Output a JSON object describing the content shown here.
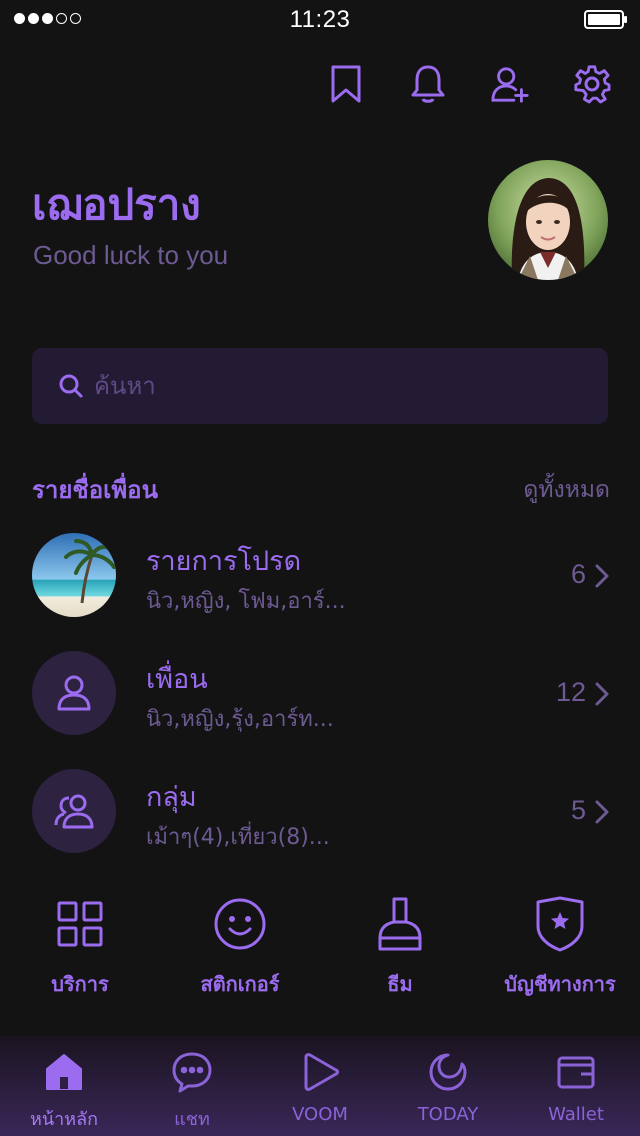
{
  "status_bar": {
    "time": "11:23",
    "signal_filled": 3,
    "signal_total": 5
  },
  "header_icons": [
    "bookmark-icon",
    "bell-icon",
    "add-friend-icon",
    "gear-icon"
  ],
  "profile": {
    "name": "เฌอปราง",
    "status": "Good luck to you",
    "avatar": "profile-photo"
  },
  "search": {
    "placeholder": "ค้นหา"
  },
  "friends_section": {
    "title": "รายชื่อเพื่อน",
    "see_all": "ดูทั้งหมด",
    "items": [
      {
        "title": "รายการโปรด",
        "subtitle": "นิว,หญิง, โฟม,อาร์...",
        "count": "6",
        "thumb": "beach-photo"
      },
      {
        "title": "เพื่อน",
        "subtitle": "นิว,หญิง,รุ้ง,อาร์ท...",
        "count": "12",
        "thumb": "person-icon"
      },
      {
        "title": "กลุ่ม",
        "subtitle": "เม้าๆ(4),เที่ยว(8)...",
        "count": "5",
        "thumb": "group-icon"
      }
    ]
  },
  "services": [
    {
      "label": "บริการ",
      "icon": "grid-icon"
    },
    {
      "label": "สติกเกอร์",
      "icon": "smiley-icon"
    },
    {
      "label": "ธีม",
      "icon": "brush-icon"
    },
    {
      "label": "บัญชีทางการ",
      "icon": "shield-star-icon"
    }
  ],
  "bottom_nav": [
    {
      "label": "หน้าหลัก",
      "icon": "home-icon",
      "active": true
    },
    {
      "label": "แชท",
      "icon": "chat-icon",
      "active": false
    },
    {
      "label": "VOOM",
      "icon": "play-icon",
      "active": false
    },
    {
      "label": "TODAY",
      "icon": "moon-icon",
      "active": false
    },
    {
      "label": "Wallet",
      "icon": "wallet-icon",
      "active": false
    }
  ],
  "colors": {
    "background": "#131313",
    "accent": "#9b6cf0",
    "muted": "#6d5a92",
    "search_bg": "#231b33"
  }
}
